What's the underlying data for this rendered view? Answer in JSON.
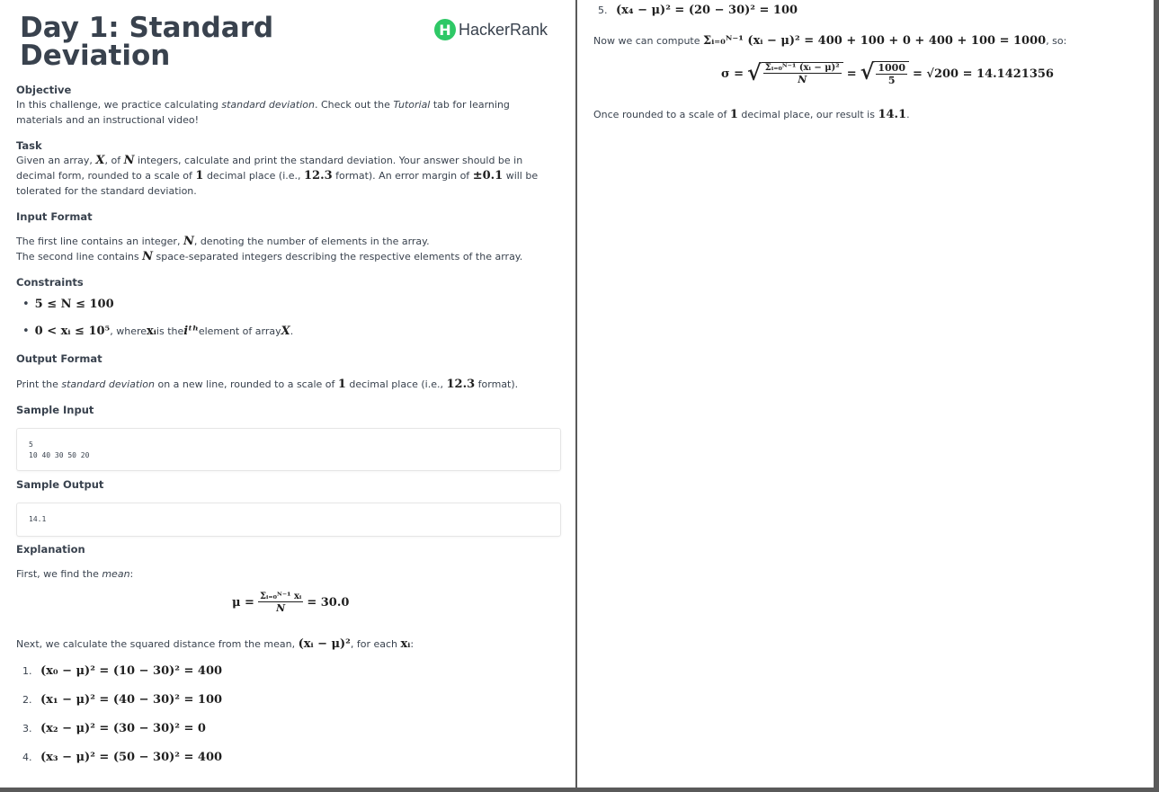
{
  "brand": {
    "name": "HackerRank",
    "mark": "H"
  },
  "title": [
    "Day 1: Standard",
    "Deviation"
  ],
  "objective": {
    "heading": "Objective",
    "p1": "In this challenge, we practice calculating ",
    "p1_em1": "standard deviation",
    "p1b": ". Check out the ",
    "p1_em2": "Tutorial",
    "p1c": " tab for learning materials and an instructional video!"
  },
  "task": {
    "heading": "Task",
    "p_a": "Given an array, ",
    "var_x": "X",
    "p_b": ", of ",
    "var_n": "N",
    "p_c": " integers, calculate and print the standard deviation. Your answer should be in decimal form, rounded to a scale of ",
    "one": "1",
    "p_d": " decimal place (i.e., ",
    "fmt": "12.3",
    "p_e": " format). An error margin of ",
    "margin": "±0.1",
    "p_f": " will be tolerated for the standard deviation."
  },
  "input_format": {
    "heading": "Input Format",
    "l1_a": "The first line contains an integer, ",
    "l1_n": "N",
    "l1_b": ", denoting the number of elements in the array.",
    "l2_a": "The second line contains ",
    "l2_n": "N",
    "l2_b": " space-separated integers describing the respective elements of the array."
  },
  "constraints": {
    "heading": "Constraints",
    "c1": "5 ≤ N ≤ 100",
    "c2_math": "0 < xᵢ ≤ 10⁵",
    "c2_a": ", where ",
    "c2_x": "xᵢ",
    "c2_b": " is the ",
    "c2_ith": "iᵗʰ",
    "c2_c": " element of array ",
    "c2_X": "X",
    "c2_d": "."
  },
  "output_format": {
    "heading": "Output Format",
    "a": "Print the ",
    "em": "standard deviation",
    "b": " on a new line, rounded to a scale of ",
    "one": "1",
    "c": " decimal place (i.e., ",
    "fmt": "12.3",
    "d": " format)."
  },
  "sample_input": {
    "heading": "Sample Input",
    "line1": "5",
    "line2": "10 40 30 50 20"
  },
  "sample_output": {
    "heading": "Sample Output",
    "value": "14.1"
  },
  "explanation": {
    "heading": "Explanation",
    "first_a": "First, we find the ",
    "first_em": "mean",
    "first_b": ":",
    "mean_lhs": "μ =",
    "mean_num": "Σᵢ₌₀ᴺ⁻¹ xᵢ",
    "mean_den": "N",
    "mean_rhs": "= 30.0",
    "next_a": "Next, we calculate the squared distance from the mean, ",
    "next_math": "(xᵢ − μ)²",
    "next_b": ", for each ",
    "next_x": "xᵢ",
    "next_c": ":",
    "items": [
      {
        "n": "1.",
        "expr": "(x₀ − μ)² = (10 − 30)² = 400"
      },
      {
        "n": "2.",
        "expr": "(x₁ − μ)² = (40 − 30)² = 100"
      },
      {
        "n": "3.",
        "expr": "(x₂ − μ)² = (30 − 30)² = 0"
      },
      {
        "n": "4.",
        "expr": "(x₃ − μ)² = (50 − 30)² = 400"
      },
      {
        "n": "5.",
        "expr": "(x₄ − μ)² = (20 − 30)² = 100"
      }
    ],
    "compute_a": "Now we can compute ",
    "compute_math": "Σᵢ₌₀ᴺ⁻¹ (xᵢ − μ)² = 400 + 100 + 0 + 400 + 100 = 1000",
    "compute_b": ", so:",
    "sigma_lhs": "σ =",
    "sigma_num": "Σᵢ₌₀ᴺ⁻¹ (xᵢ − μ)²",
    "sigma_den": "N",
    "sigma_eq": "=",
    "sigma_num2": "1000",
    "sigma_den2": "5",
    "sigma_rhs": "= √200 = 14.1421356",
    "round_a": "Once rounded to a scale of ",
    "round_one": "1",
    "round_b": " decimal place, our result is ",
    "round_val": "14.1",
    "round_c": "."
  }
}
